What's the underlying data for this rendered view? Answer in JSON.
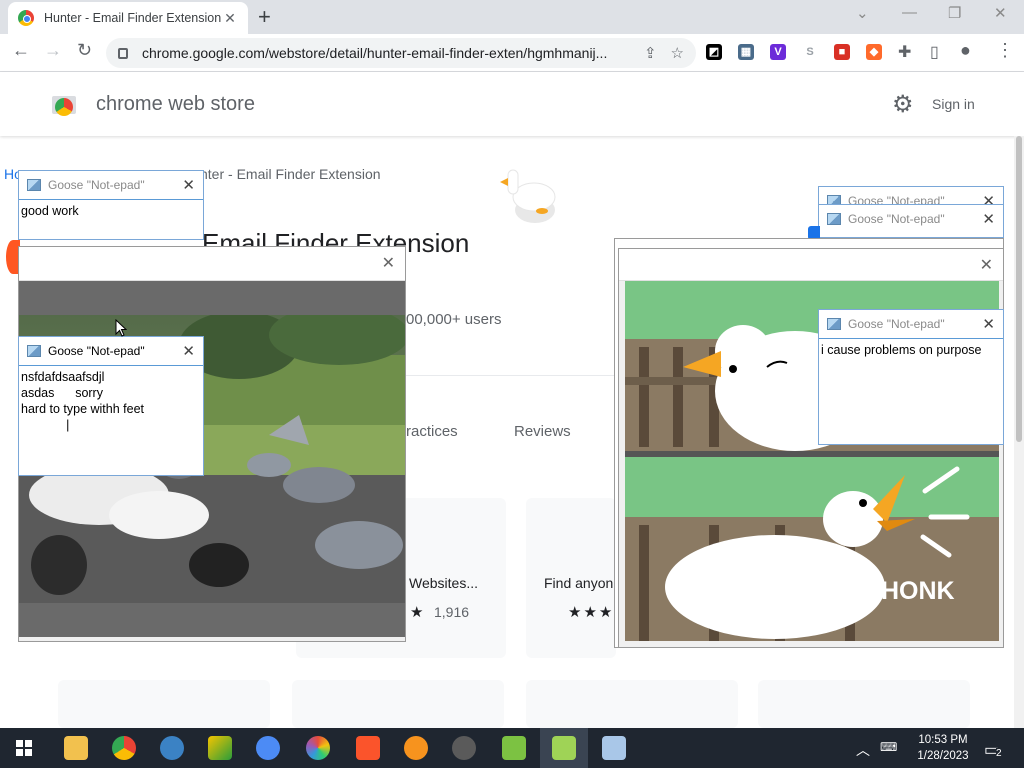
{
  "browser": {
    "tab_title": "Hunter - Email Finder Extension",
    "url": "chrome.google.com/webstore/detail/hunter-email-finder-exten/hgmhmanij..."
  },
  "store": {
    "name": "chrome web store",
    "sign_in": "Sign in",
    "breadcrumb_start": "Ho",
    "breadcrumb_end": "nter - Email Finder Extension",
    "title": "Email Finder Extension",
    "users": "00,000+ users",
    "tab_practices": "ractices",
    "tab_reviews": "Reviews",
    "related_1_title": "Websites...",
    "related_1_count": "1,916",
    "related_2_title": "Find anyon"
  },
  "goose": {
    "window_title": "Goose \"Not-epad\"",
    "note_1": "good work",
    "note_2": "nsfdafdsaafsdjl\nasdas      sorry\nhard to type withh feet\n             |",
    "note_3": "i cause problems on purpose",
    "honk_label": "HONK"
  },
  "taskbar": {
    "time": "10:53 PM",
    "date": "1/28/2023",
    "notifications": "2"
  },
  "colors": {
    "chrome_tab_strip": "#dee1e6",
    "goose_border": "#7aa7d8",
    "taskbar": "#1f2630"
  }
}
